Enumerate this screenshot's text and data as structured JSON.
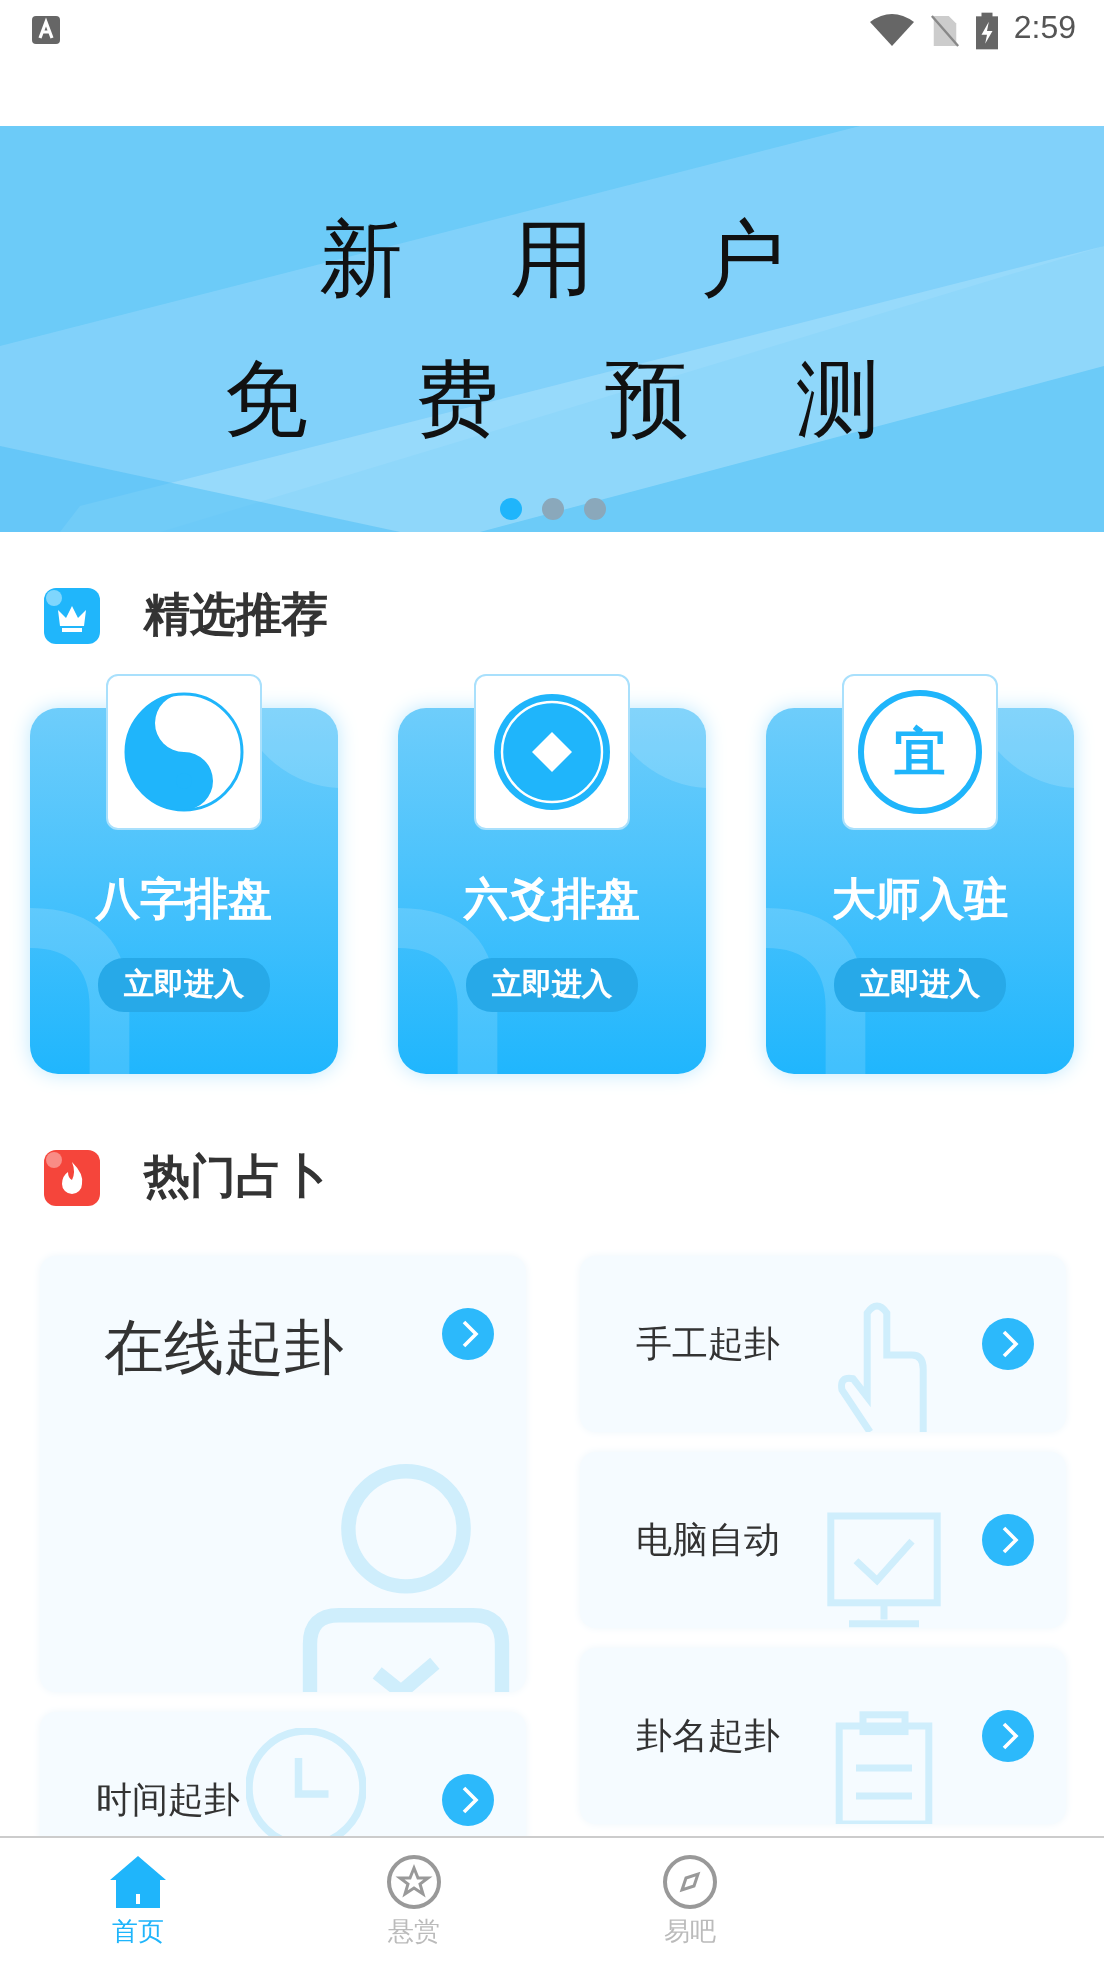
{
  "status_bar": {
    "time": "2:59"
  },
  "banner": {
    "line_1": "新 用 户",
    "line_2": "免 费 预 测",
    "dots": [
      {
        "selected": true
      },
      {
        "selected": false
      },
      {
        "selected": false
      }
    ]
  },
  "featured": {
    "title": "精选推荐",
    "cards": [
      {
        "kind": "taiji",
        "title": "八字排盘",
        "button": "立即进入"
      },
      {
        "kind": "coin",
        "title": "六爻排盘",
        "button": "立即进入"
      },
      {
        "kind": "seal",
        "seal_text": "宜",
        "title": "大师入驻",
        "button": "立即进入"
      }
    ]
  },
  "hot": {
    "title": "热门占卜",
    "columns": [
      [
        {
          "kind": "person",
          "label": "在线起卦"
        },
        {
          "kind": "clock",
          "label": "时间起卦"
        }
      ],
      [
        {
          "kind": "hand",
          "label": "手工起卦"
        },
        {
          "kind": "monitor",
          "label": "电脑自动"
        },
        {
          "kind": "clipboard",
          "label": "卦名起卦"
        }
      ]
    ]
  },
  "tab_bar": [
    {
      "kind": "home",
      "label": "首页",
      "selected": true
    },
    {
      "kind": "star",
      "label": "悬赏",
      "selected": false
    },
    {
      "kind": "compass",
      "label": "易吧",
      "selected": false
    }
  ]
}
